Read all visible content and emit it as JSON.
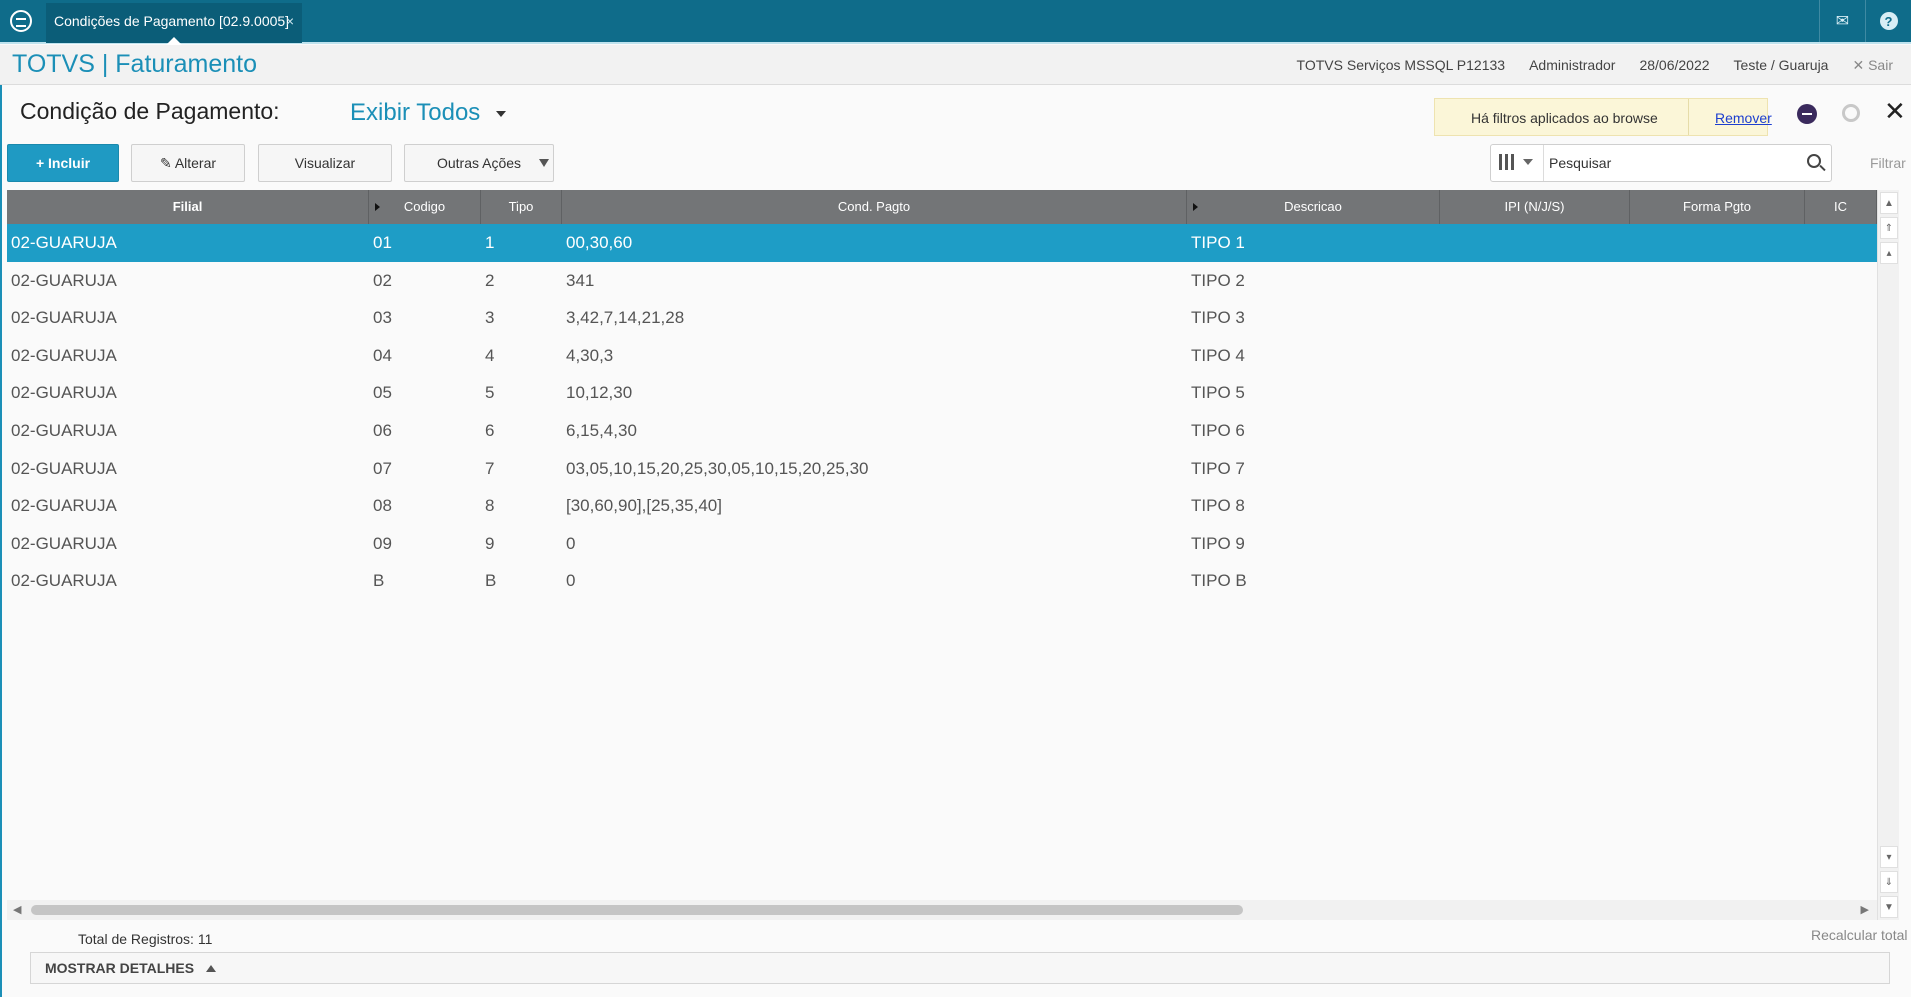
{
  "topbar": {
    "tab_title": "Condições de Pagamento [02.9.0005]",
    "tab_close": "×",
    "mail_icon": "mail-icon",
    "help_label": "?"
  },
  "appbar": {
    "title": "TOTVS | Faturamento",
    "server": "TOTVS Serviços MSSQL P12133",
    "user": "Administrador",
    "date": "28/06/2022",
    "branch": "Teste / Guaruja",
    "logout": "Sair"
  },
  "page": {
    "title": "Condição de Pagamento:",
    "view": "Exibir Todos",
    "filter_notice": "Há filtros aplicados ao browse",
    "filter_remove": "Remover"
  },
  "toolbar": {
    "incluir": "Incluir",
    "alterar": "Alterar",
    "visualizar": "Visualizar",
    "outras": "Outras Ações",
    "search_placeholder": "Pesquisar",
    "filtrar": "Filtrar"
  },
  "grid": {
    "columns": [
      "Filial",
      "Codigo",
      "Tipo",
      "Cond. Pagto",
      "Descricao",
      "IPI (N/J/S)",
      "Forma Pgto",
      "IC"
    ],
    "rows": [
      {
        "filial": "02-GUARUJA",
        "codigo": "01",
        "tipo": "1",
        "cond": "00,30,60",
        "desc": "TIPO 1"
      },
      {
        "filial": "02-GUARUJA",
        "codigo": "02",
        "tipo": "2",
        "cond": "341",
        "desc": "TIPO 2"
      },
      {
        "filial": "02-GUARUJA",
        "codigo": "03",
        "tipo": "3",
        "cond": "3,42,7,14,21,28",
        "desc": "TIPO 3"
      },
      {
        "filial": "02-GUARUJA",
        "codigo": "04",
        "tipo": "4",
        "cond": "4,30,3",
        "desc": "TIPO 4"
      },
      {
        "filial": "02-GUARUJA",
        "codigo": "05",
        "tipo": "5",
        "cond": "10,12,30",
        "desc": "TIPO 5"
      },
      {
        "filial": "02-GUARUJA",
        "codigo": "06",
        "tipo": "6",
        "cond": "6,15,4,30",
        "desc": "TIPO 6"
      },
      {
        "filial": "02-GUARUJA",
        "codigo": "07",
        "tipo": "7",
        "cond": "03,05,10,15,20,25,30,05,10,15,20,25,30",
        "desc": "TIPO 7"
      },
      {
        "filial": "02-GUARUJA",
        "codigo": "08",
        "tipo": "8",
        "cond": "[30,60,90],[25,35,40]",
        "desc": "TIPO 8"
      },
      {
        "filial": "02-GUARUJA",
        "codigo": "09",
        "tipo": "9",
        "cond": "0",
        "desc": "TIPO 9"
      },
      {
        "filial": "02-GUARUJA",
        "codigo": "B",
        "tipo": "B",
        "cond": "0",
        "desc": "TIPO B"
      }
    ]
  },
  "footer": {
    "total": "Total de Registros: 11",
    "recalc": "Recalcular total",
    "details": "MOSTRAR DETALHES"
  },
  "colors": {
    "brand": "#0f6c8a",
    "accent": "#1f9ac3",
    "selected_row": "#1e9dc6",
    "grid_header": "#737577"
  }
}
